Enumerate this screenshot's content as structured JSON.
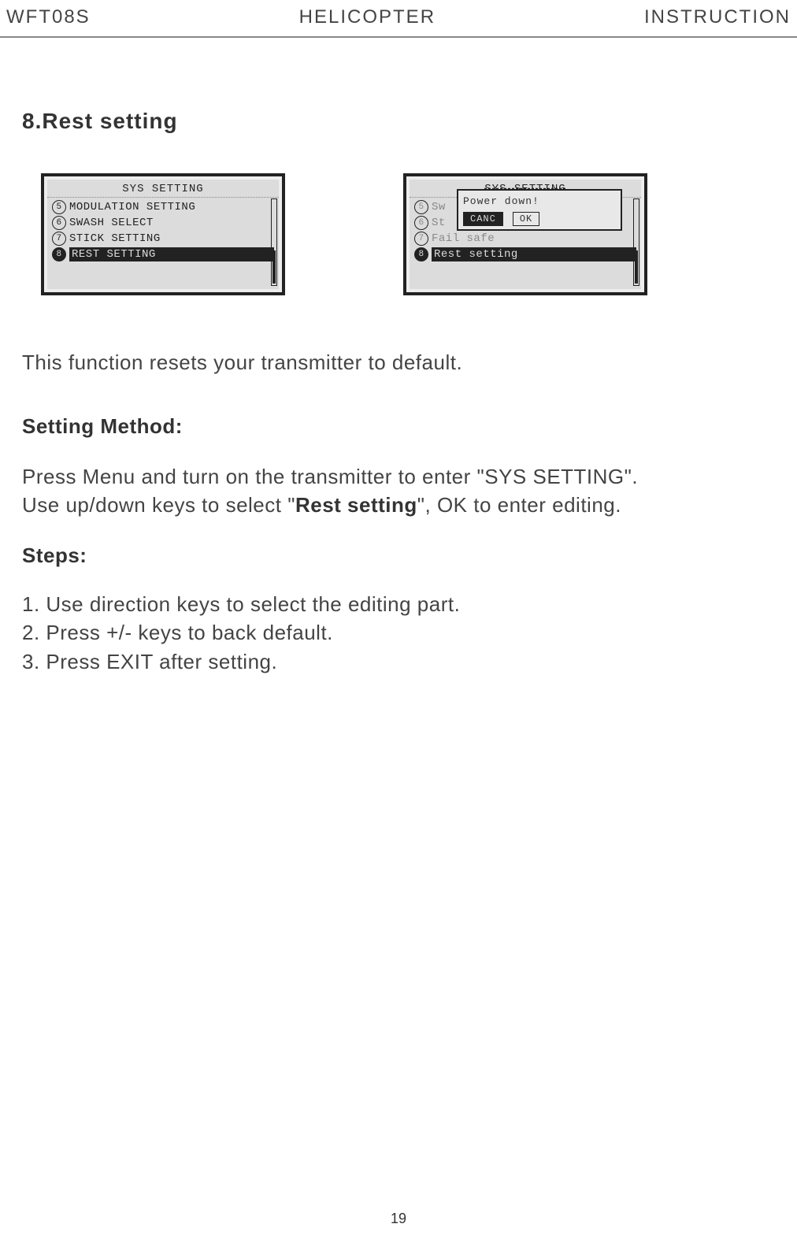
{
  "header": {
    "left": "WFT08S",
    "center": "HELICOPTER",
    "right": "INSTRUCTION"
  },
  "section": {
    "title": "8.Rest setting"
  },
  "lcd1": {
    "title": "SYS SETTING",
    "items": [
      {
        "num": "5",
        "text": "MODULATION SETTING",
        "filled": false,
        "highlighted": false
      },
      {
        "num": "6",
        "text": "SWASH SELECT",
        "filled": false,
        "highlighted": false
      },
      {
        "num": "7",
        "text": "STICK SETTING",
        "filled": false,
        "highlighted": false
      },
      {
        "num": "8",
        "text": "REST SETTING",
        "filled": true,
        "highlighted": true
      }
    ]
  },
  "lcd2": {
    "title": "SYS SETTING",
    "items": [
      {
        "num": "5",
        "text": "Sw",
        "filled": false,
        "highlighted": false
      },
      {
        "num": "6",
        "text": "St",
        "filled": false,
        "highlighted": false
      },
      {
        "num": "7",
        "text": "Fail safe",
        "filled": false,
        "highlighted": false
      },
      {
        "num": "8",
        "text": "Rest setting",
        "filled": true,
        "highlighted": true
      }
    ],
    "dialog": {
      "text": "Power down!",
      "btn1": "CANC",
      "btn2": "OK"
    }
  },
  "description": "This function resets your transmitter to default.",
  "method": {
    "title": "Setting Method:",
    "text1": "Press Menu and turn on the transmitter to enter \"SYS SETTING\".",
    "text2a": "Use up/down keys to select \"",
    "text2bold": "Rest setting",
    "text2b": "\", OK to enter editing."
  },
  "steps": {
    "title": "Steps:",
    "s1": "1. Use direction keys to select the editing part.",
    "s2": "2. Press +/- keys to back default.",
    "s3": "3. Press EXIT after setting."
  },
  "page": "19"
}
